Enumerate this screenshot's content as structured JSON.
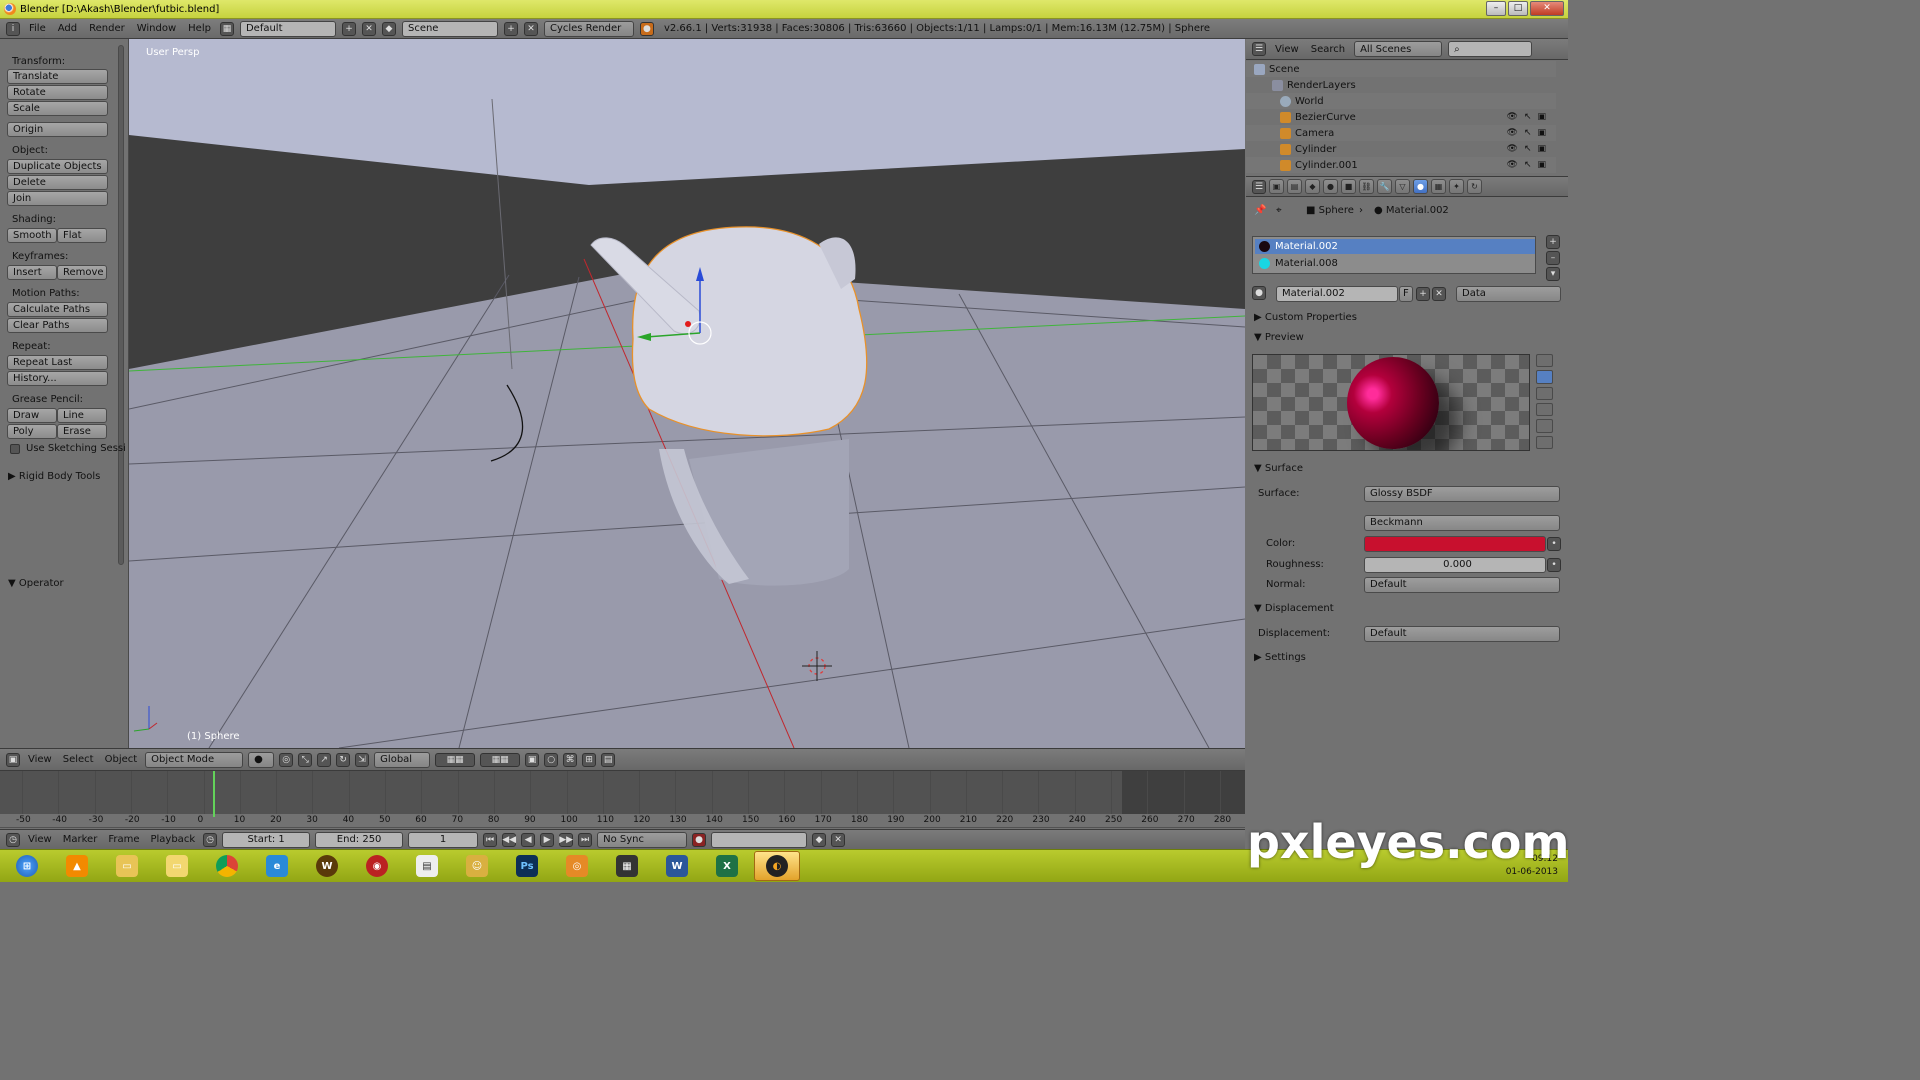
{
  "window": {
    "title": "Blender  [D:\\Akash\\Blender\\futbic.blend]"
  },
  "info": {
    "menus": [
      "File",
      "Add",
      "Render",
      "Window",
      "Help"
    ],
    "layout": "Default",
    "scene": "Scene",
    "engine": "Cycles Render",
    "stats": "v2.66.1 | Verts:31938 | Faces:30806 | Tris:63660 | Objects:1/11 | Lamps:0/1 | Mem:16.13M (12.75M) | Sphere"
  },
  "toolshelf": {
    "transform": "Transform:",
    "translate": "Translate",
    "rotate": "Rotate",
    "scale": "Scale",
    "origin": "Origin",
    "object": "Object:",
    "duplicate": "Duplicate Objects",
    "delete": "Delete",
    "join": "Join",
    "shading": "Shading:",
    "smooth": "Smooth",
    "flat": "Flat",
    "keyframes": "Keyframes:",
    "insert": "Insert",
    "remove": "Remove",
    "motion": "Motion Paths:",
    "calc": "Calculate Paths",
    "clear": "Clear Paths",
    "repeat": "Repeat:",
    "repeat_last": "Repeat Last",
    "history": "History...",
    "grease": "Grease Pencil:",
    "draw": "Draw",
    "line": "Line",
    "poly": "Poly",
    "erase": "Erase",
    "sketch": "Use Sketching Sessi",
    "rigid": "Rigid Body Tools",
    "operator": "Operator"
  },
  "viewport": {
    "persp": "User Persp",
    "object": "(1) Sphere"
  },
  "vpheader": {
    "view": "View",
    "select": "Select",
    "object": "Object",
    "mode": "Object Mode",
    "orientation": "Global"
  },
  "timeline": {
    "ticks": [
      "-50",
      "-40",
      "-30",
      "-20",
      "-10",
      "0",
      "10",
      "20",
      "30",
      "40",
      "50",
      "60",
      "70",
      "80",
      "90",
      "100",
      "110",
      "120",
      "130",
      "140",
      "150",
      "160",
      "170",
      "180",
      "190",
      "200",
      "210",
      "220",
      "230",
      "240",
      "250",
      "260",
      "270",
      "280"
    ],
    "view": "View",
    "marker": "Marker",
    "frame": "Frame",
    "playback": "Playback",
    "start": "Start: 1",
    "end": "End: 250",
    "current": "1",
    "sync": "No Sync"
  },
  "outliner": {
    "view": "View",
    "search": "Search",
    "scenes": "All Scenes",
    "rows": [
      "Scene",
      "RenderLayers",
      "World",
      "BezierCurve",
      "Camera",
      "Cylinder",
      "Cylinder.001"
    ]
  },
  "properties": {
    "crumb_obj": "Sphere",
    "crumb_mat": "Material.002",
    "materials": [
      "Material.002",
      "Material.008"
    ],
    "mat_name": "Material.002",
    "f": "F",
    "link": "Data",
    "custom": "Custom Properties",
    "preview": "Preview",
    "surface_hdr": "Surface",
    "surface_lbl": "Surface:",
    "surface_val": "Glossy BSDF",
    "dist": "Beckmann",
    "color_lbl": "Color:",
    "rough_lbl": "Roughness:",
    "rough_val": "0.000",
    "normal_lbl": "Normal:",
    "normal_val": "Default",
    "disp_hdr": "Displacement",
    "disp_lbl": "Displacement:",
    "disp_val": "Default",
    "settings": "Settings"
  },
  "taskbar": {
    "time": "09:12",
    "date": "01-06-2013",
    "ps": "Ps",
    "w": "W"
  },
  "watermark": "pxleyes.com",
  "colors": {
    "accent": "#5680c2",
    "material_color": "#c8102e"
  }
}
